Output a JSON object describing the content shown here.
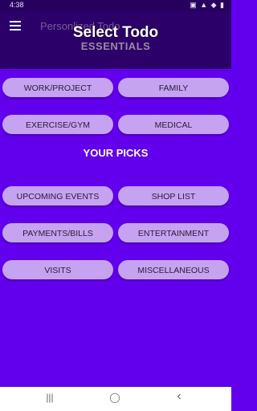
{
  "status_bar": {
    "time": "4:38",
    "icons": "▣ ▲ ◆ ▮"
  },
  "app_bar": {
    "title": "Personlized Todo",
    "overlay_title": "Select Todo",
    "section_title": "ESSENTIALS"
  },
  "essentials": [
    {
      "label": "WORK/PROJECT"
    },
    {
      "label": "FAMILY"
    },
    {
      "label": "EXERCISE/GYM"
    },
    {
      "label": "MEDICAL"
    }
  ],
  "picks_title": "YOUR PICKS",
  "picks": [
    {
      "label": "UPCOMING EVENTS"
    },
    {
      "label": "SHOP LIST"
    },
    {
      "label": "PAYMENTS/BILLS"
    },
    {
      "label": "ENTERTAINMENT"
    },
    {
      "label": "VISITS"
    },
    {
      "label": "MISCELLANEOUS"
    }
  ],
  "nav": {
    "recents": "|||",
    "home": "◯",
    "back": "‹"
  },
  "colors": {
    "background": "#6200ee",
    "app_bar": "#2b0068",
    "button": "#c5a3f0"
  }
}
